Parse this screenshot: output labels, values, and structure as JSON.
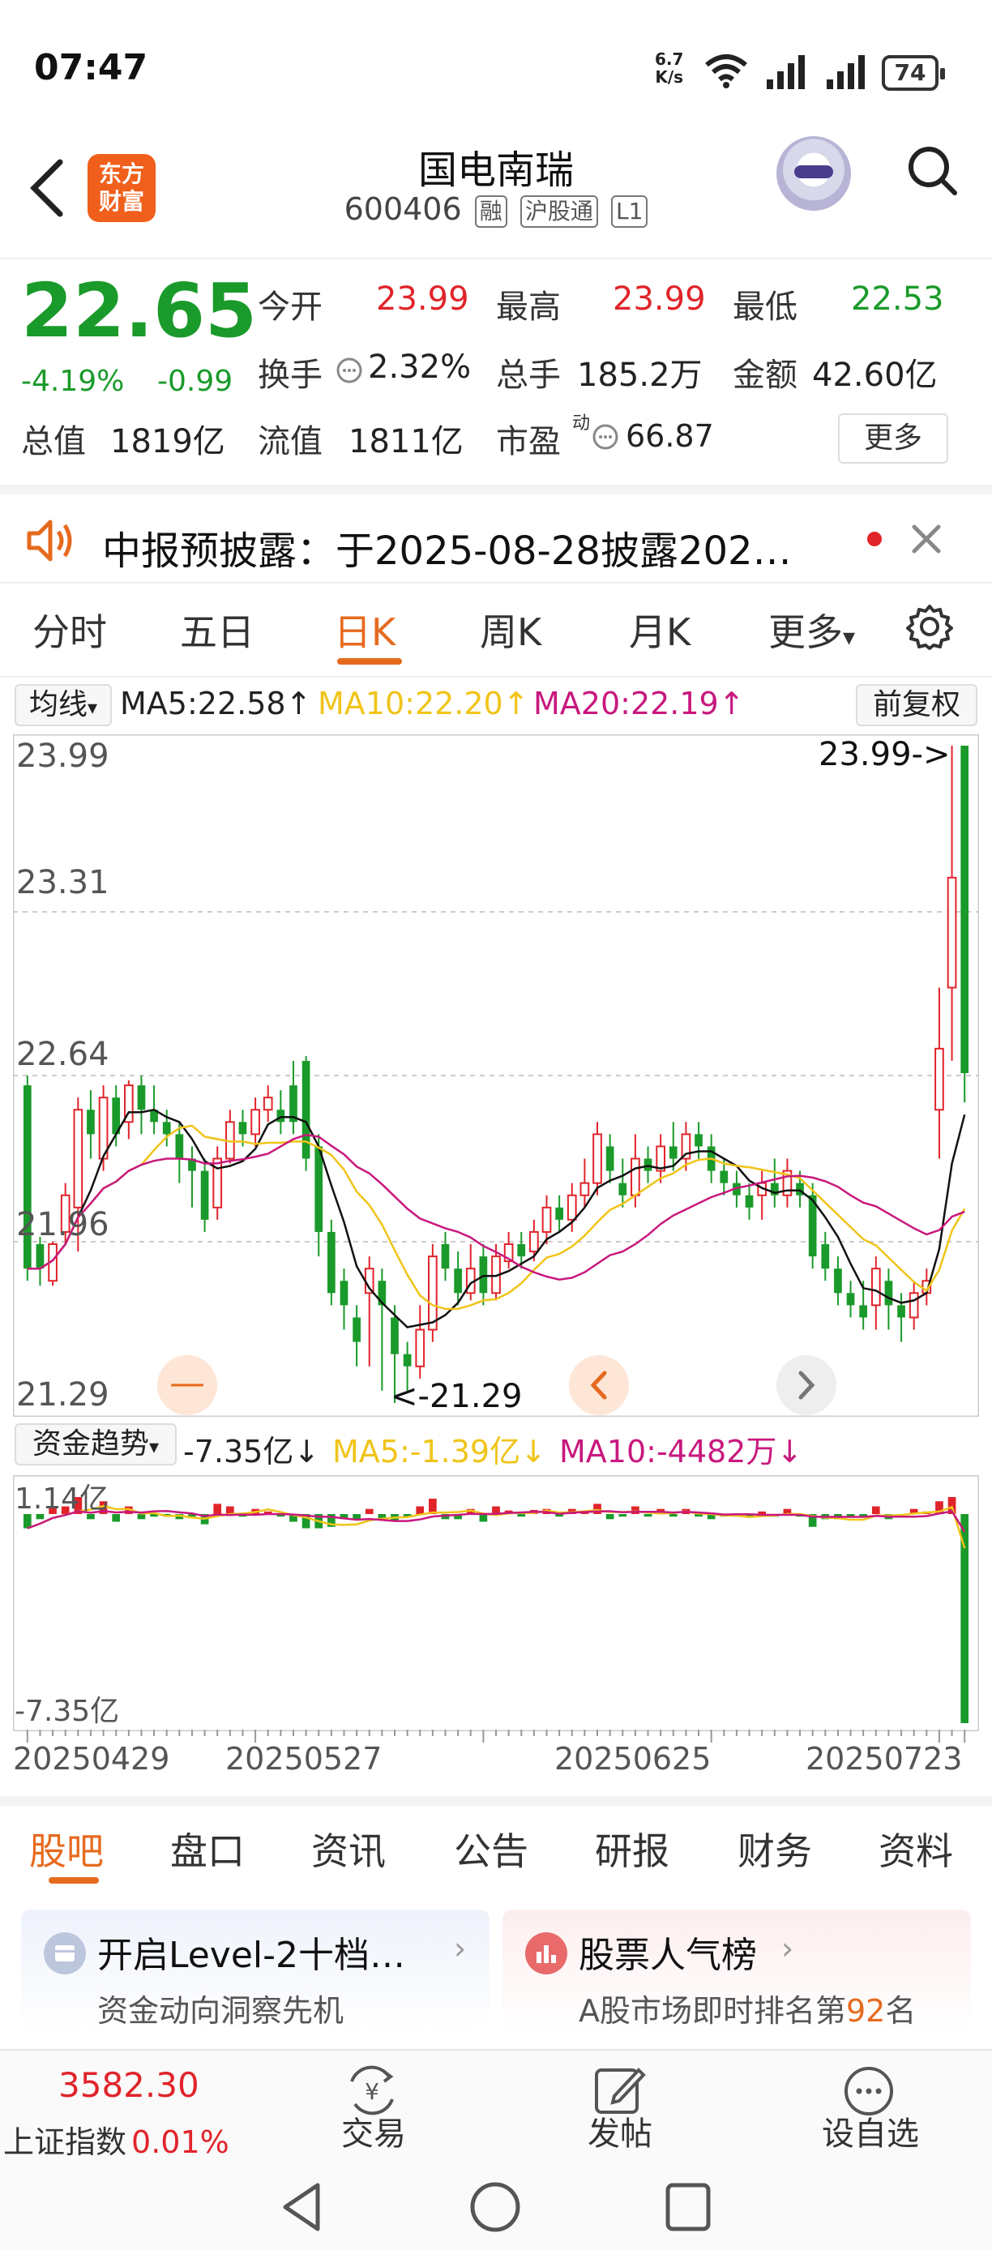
{
  "status_bar": {
    "time": "07:47",
    "net_speed_value": "6.7",
    "net_speed_unit": "K/s",
    "battery": "74"
  },
  "header": {
    "back_icon": "back-arrow-icon",
    "logo_line1": "东方",
    "logo_line2": "财富",
    "name": "国电南瑞",
    "code": "600406",
    "tags": [
      "融",
      "沪股通",
      "L1"
    ]
  },
  "quote": {
    "price": "22.65",
    "change_pct": "-4.19%",
    "change_amt": "-0.99",
    "open_label": "今开",
    "open": "23.99",
    "high_label": "最高",
    "high": "23.99",
    "low_label": "最低",
    "low": "22.53",
    "turnover_label": "换手",
    "turnover": "2.32%",
    "volume_label": "总手",
    "volume": "185.2万",
    "amount_label": "金额",
    "amount": "42.60亿",
    "mcap_label": "总值",
    "mcap": "1819亿",
    "float_label": "流值",
    "float": "1811亿",
    "pe_label": "市盈",
    "pe_sup": "动",
    "pe": "66.87",
    "more": "更多"
  },
  "notice": {
    "text": "中报预披露：于2025-08-28披露202…"
  },
  "chart_tabs": [
    "分时",
    "五日",
    "日K",
    "周K",
    "月K",
    "更多"
  ],
  "chart_tabs_active": 2,
  "ma_bar": {
    "selector": "均线",
    "ma5": "MA5:22.58",
    "ma10": "MA10:22.20",
    "ma20": "MA20:22.19",
    "adjust": "前复权"
  },
  "price_axis": [
    "23.99",
    "23.31",
    "22.64",
    "21.96",
    "21.29"
  ],
  "annotations": {
    "high": "23.99->",
    "low": "<-21.29"
  },
  "fund_bar": {
    "selector": "资金趋势",
    "value": "-7.35亿",
    "ma5": "MA5:-1.39亿",
    "ma10": "MA10:-4482万"
  },
  "fund_axis": [
    "1.14亿",
    "-7.35亿"
  ],
  "date_axis": [
    "20250429",
    "20250527",
    "20250625",
    "20250723"
  ],
  "bottom_tabs": [
    "股吧",
    "盘口",
    "资讯",
    "公告",
    "研报",
    "财务",
    "资料"
  ],
  "cards": {
    "left_title": "开启Level-2十档…",
    "left_sub": "资金动向洞察先机",
    "right_title": "股票人气榜",
    "right_sub_pre": "A股市场即时排名第",
    "right_rank": "92",
    "right_sub_post": "名"
  },
  "bottom_nav": {
    "index_value": "3582.30",
    "index_name": "上证指数",
    "index_change": "0.01%",
    "trade": "交易",
    "post": "发帖",
    "watch": "设自选"
  },
  "colors": {
    "up": "#e0242a",
    "down": "#1a9a2a",
    "accent": "#e66a1e",
    "ma10": "#f0c419",
    "ma20": "#c8187e"
  },
  "chart_data": {
    "type": "candlestick",
    "ylim": [
      21.29,
      23.99
    ],
    "candles": [
      [
        22.6,
        21.85,
        22.64,
        21.8
      ],
      [
        21.95,
        21.85,
        21.98,
        21.78
      ],
      [
        21.8,
        21.95,
        21.96,
        21.78
      ],
      [
        22.0,
        22.15,
        22.2,
        21.95
      ],
      [
        22.1,
        22.5,
        22.55,
        21.92
      ],
      [
        22.5,
        22.4,
        22.58,
        22.3
      ],
      [
        22.3,
        22.55,
        22.6,
        22.25
      ],
      [
        22.55,
        22.4,
        22.6,
        22.35
      ],
      [
        22.45,
        22.6,
        22.62,
        22.38
      ],
      [
        22.6,
        22.5,
        22.64,
        22.4
      ],
      [
        22.5,
        22.45,
        22.6,
        22.4
      ],
      [
        22.45,
        22.4,
        22.5,
        22.35
      ],
      [
        22.4,
        22.3,
        22.45,
        22.2
      ],
      [
        22.3,
        22.25,
        22.35,
        22.1
      ],
      [
        22.25,
        22.05,
        22.3,
        22.0
      ],
      [
        22.1,
        22.3,
        22.35,
        22.05
      ],
      [
        22.3,
        22.45,
        22.5,
        22.28
      ],
      [
        22.45,
        22.4,
        22.5,
        22.35
      ],
      [
        22.4,
        22.5,
        22.55,
        22.35
      ],
      [
        22.5,
        22.55,
        22.6,
        22.45
      ],
      [
        22.5,
        22.45,
        22.58,
        22.4
      ],
      [
        22.6,
        22.45,
        22.7,
        22.4
      ],
      [
        22.7,
        22.3,
        22.72,
        22.25
      ],
      [
        22.35,
        22.0,
        22.4,
        21.9
      ],
      [
        22.0,
        21.75,
        22.05,
        21.7
      ],
      [
        21.8,
        21.7,
        21.85,
        21.6
      ],
      [
        21.65,
        21.55,
        21.7,
        21.45
      ],
      [
        21.75,
        21.85,
        21.9,
        21.45
      ],
      [
        21.8,
        21.7,
        21.85,
        21.35
      ],
      [
        21.65,
        21.5,
        21.7,
        21.3
      ],
      [
        21.5,
        21.45,
        21.55,
        21.35
      ],
      [
        21.45,
        21.6,
        21.7,
        21.4
      ],
      [
        21.6,
        21.9,
        21.95,
        21.55
      ],
      [
        21.95,
        21.85,
        22.0,
        21.8
      ],
      [
        21.85,
        21.75,
        21.92,
        21.7
      ],
      [
        21.75,
        21.85,
        21.95,
        21.72
      ],
      [
        21.9,
        21.75,
        21.95,
        21.7
      ],
      [
        21.75,
        21.9,
        21.95,
        21.72
      ],
      [
        21.88,
        21.95,
        22.0,
        21.85
      ],
      [
        21.95,
        21.9,
        22.0,
        21.85
      ],
      [
        21.92,
        22.0,
        22.05,
        21.88
      ],
      [
        22.0,
        22.1,
        22.15,
        21.95
      ],
      [
        22.1,
        22.05,
        22.15,
        22.0
      ],
      [
        22.05,
        22.15,
        22.2,
        22.0
      ],
      [
        22.15,
        22.2,
        22.3,
        22.1
      ],
      [
        22.2,
        22.4,
        22.45,
        22.15
      ],
      [
        22.35,
        22.25,
        22.4,
        22.2
      ],
      [
        22.2,
        22.15,
        22.3,
        22.1
      ],
      [
        22.15,
        22.3,
        22.4,
        22.1
      ],
      [
        22.3,
        22.25,
        22.35,
        22.2
      ],
      [
        22.25,
        22.35,
        22.4,
        22.2
      ],
      [
        22.35,
        22.3,
        22.45,
        22.25
      ],
      [
        22.3,
        22.4,
        22.45,
        22.25
      ],
      [
        22.4,
        22.35,
        22.45,
        22.3
      ],
      [
        22.35,
        22.25,
        22.4,
        22.2
      ],
      [
        22.25,
        22.2,
        22.3,
        22.15
      ],
      [
        22.2,
        22.15,
        22.25,
        22.1
      ],
      [
        22.15,
        22.1,
        22.2,
        22.05
      ],
      [
        22.15,
        22.2,
        22.25,
        22.05
      ],
      [
        22.2,
        22.15,
        22.3,
        22.1
      ],
      [
        22.15,
        22.25,
        22.3,
        22.1
      ],
      [
        22.2,
        22.15,
        22.25,
        22.1
      ],
      [
        22.15,
        21.9,
        22.2,
        21.85
      ],
      [
        21.95,
        21.85,
        22.0,
        21.8
      ],
      [
        21.85,
        21.75,
        21.9,
        21.7
      ],
      [
        21.75,
        21.7,
        21.8,
        21.65
      ],
      [
        21.7,
        21.65,
        21.8,
        21.6
      ],
      [
        21.7,
        21.85,
        21.9,
        21.6
      ],
      [
        21.8,
        21.7,
        21.85,
        21.6
      ],
      [
        21.7,
        21.65,
        21.75,
        21.55
      ],
      [
        21.65,
        21.75,
        21.8,
        21.6
      ],
      [
        21.75,
        21.8,
        21.85,
        21.7
      ],
      [
        22.5,
        22.75,
        23.0,
        22.3
      ],
      [
        23.0,
        23.45,
        23.99,
        22.7
      ],
      [
        23.99,
        22.65,
        23.99,
        22.53
      ]
    ],
    "fund_flow_unit": "亿",
    "fund_flow_ylim": [
      -7.35,
      1.14
    ]
  }
}
